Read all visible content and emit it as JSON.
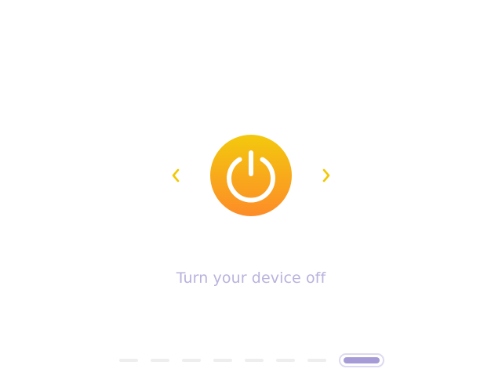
{
  "slide": {
    "caption": "Turn your device off",
    "icon": "power-icon",
    "current_page": 8,
    "total_pages": 8
  },
  "navigation": {
    "prev_icon": "chevron-left-icon",
    "next_icon": "chevron-right-icon"
  },
  "colors": {
    "accent_top": "#f3c90d",
    "accent_bottom": "#fd8c28",
    "arrow": "#f2c800",
    "caption_text": "#b9b2dd",
    "pager_inactive": "#eeeeee",
    "pager_active": "#a69bd6",
    "pager_active_border": "#ddd9f0",
    "background": "#ffffff"
  }
}
